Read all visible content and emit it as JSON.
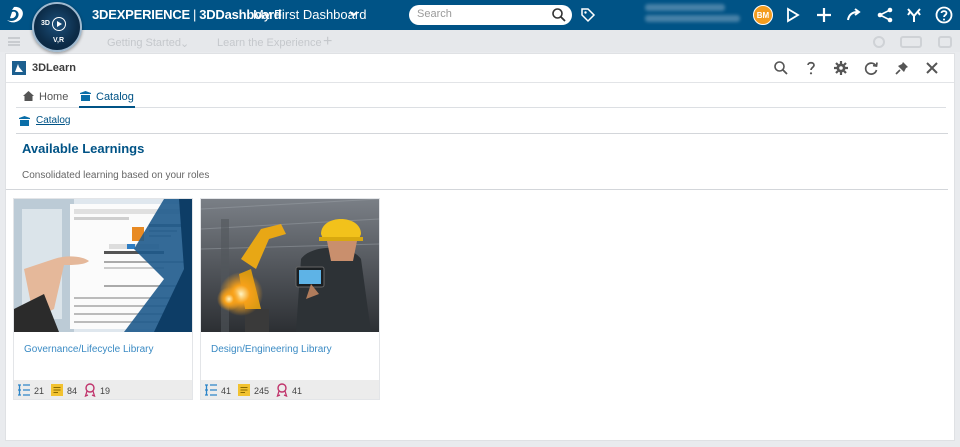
{
  "topbar": {
    "brand": "3DEXPERIENCE",
    "brand_sep": "|",
    "brand_app": "3DDashboard",
    "dashboard_title": "My First Dashboard",
    "compass_3d": "3D",
    "compass_vr": "V,R",
    "search_placeholder": "Search",
    "avatar_initials": "BM",
    "accent": "#005386"
  },
  "dashbar": {
    "tab1": "Getting Started",
    "tab2": "Learn the Experience"
  },
  "panel": {
    "title": "3DLearn",
    "tabs": [
      {
        "label": "Home"
      },
      {
        "label": "Catalog"
      }
    ],
    "breadcrumb": "Catalog",
    "heading": "Available Learnings",
    "subheading": "Consolidated learning based on your roles"
  },
  "cards": [
    {
      "title": "Governance/Lifecycle Library",
      "modules": "21",
      "docs": "84",
      "awards": "19"
    },
    {
      "title": "Design/Engineering Library",
      "modules": "41",
      "docs": "245",
      "awards": "41"
    }
  ]
}
